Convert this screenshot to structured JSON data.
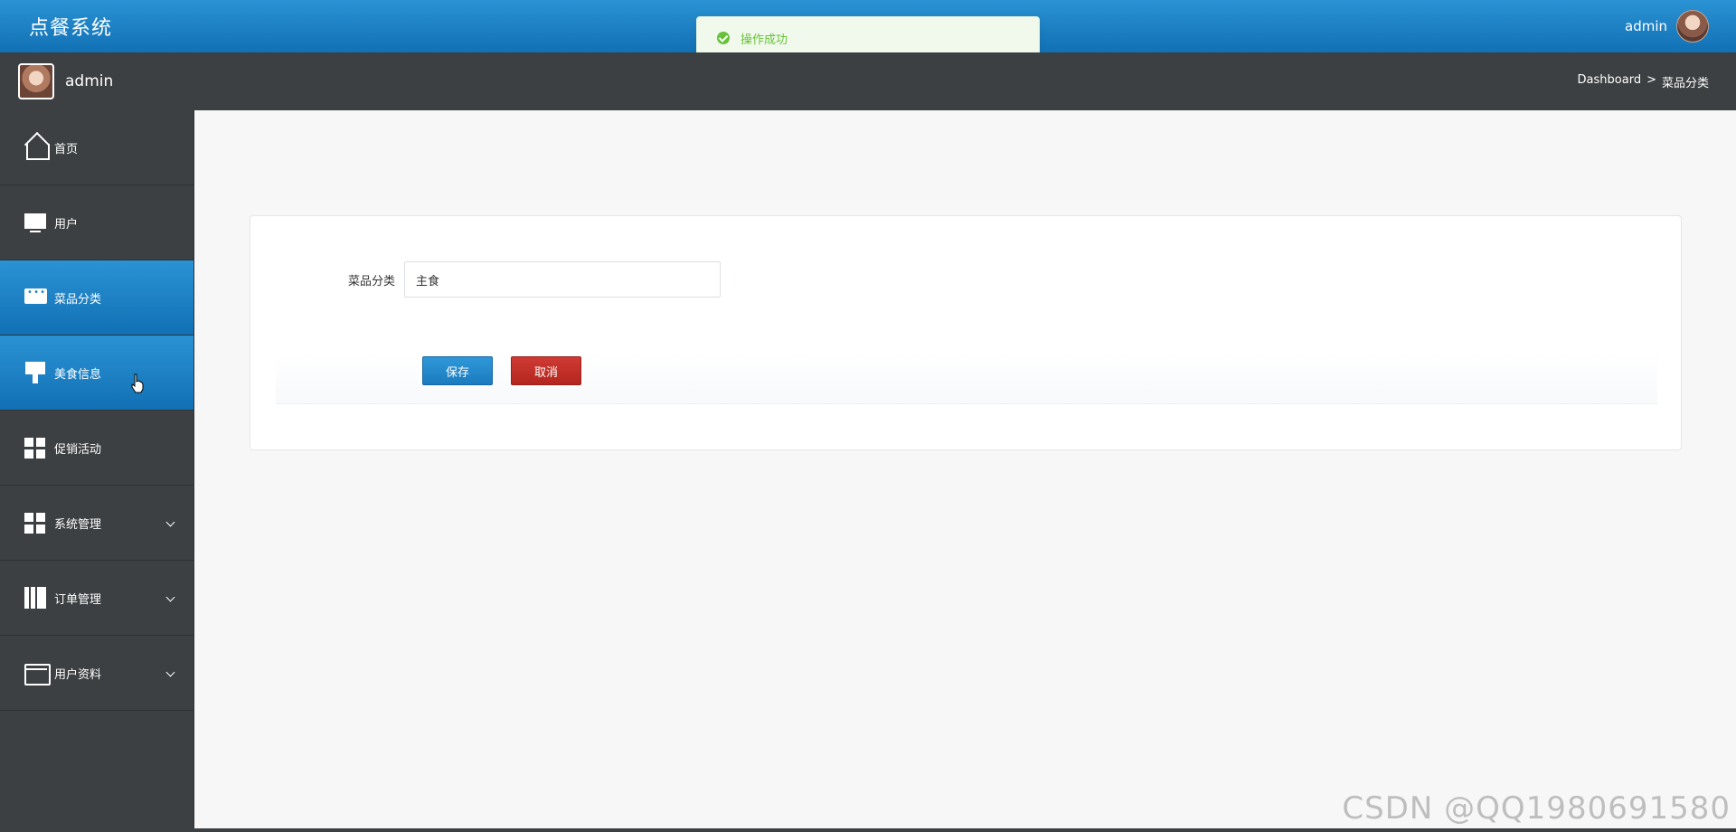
{
  "header": {
    "title": "点餐系统",
    "username": "admin"
  },
  "toast": {
    "message": "操作成功",
    "color": "#67c23a"
  },
  "subbar": {
    "username": "admin",
    "breadcrumb": {
      "root": "Dashboard",
      "separator": ">",
      "current": "菜品分类"
    }
  },
  "sidebar": {
    "items": [
      {
        "label": "首页",
        "icon": "home-icon",
        "active": false,
        "expandable": false
      },
      {
        "label": "用户",
        "icon": "monitor-icon",
        "active": false,
        "expandable": false
      },
      {
        "label": "菜品分类",
        "icon": "chat-icon",
        "active": true,
        "expandable": false
      },
      {
        "label": "美食信息",
        "icon": "brush-icon",
        "active": true,
        "expandable": false
      },
      {
        "label": "促销活动",
        "icon": "grid-icon",
        "active": false,
        "expandable": false
      },
      {
        "label": "系统管理",
        "icon": "grid-icon",
        "active": false,
        "expandable": true
      },
      {
        "label": "订单管理",
        "icon": "book-icon",
        "active": false,
        "expandable": true
      },
      {
        "label": "用户资料",
        "icon": "card-icon",
        "active": false,
        "expandable": true
      }
    ]
  },
  "form": {
    "category_label": "菜品分类",
    "category_value": "主食",
    "save_label": "保存",
    "cancel_label": "取消"
  },
  "watermark": "CSDN @QQ1980691580",
  "colors": {
    "header_blue": "#1a7fc4",
    "sidebar_bg": "#3d4042",
    "save_button": "#1b7bbf",
    "cancel_button": "#b3261f"
  }
}
